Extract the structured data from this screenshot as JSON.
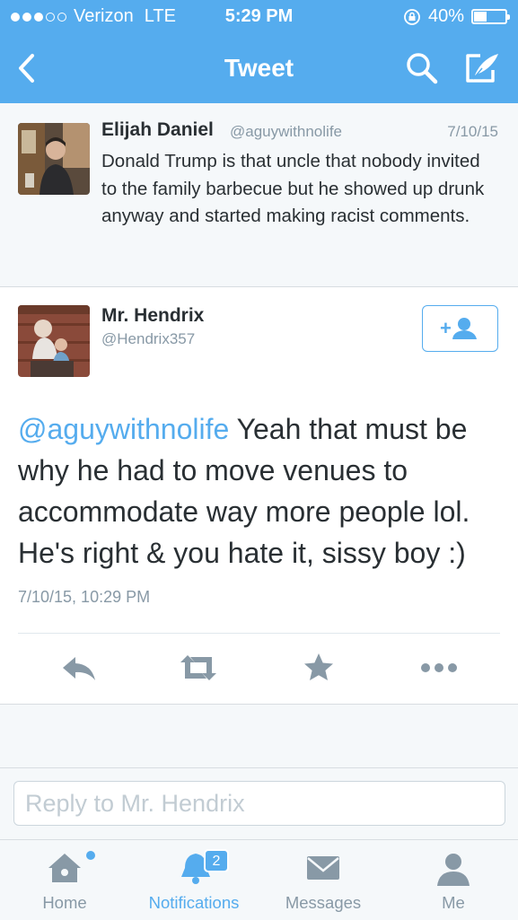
{
  "status_bar": {
    "carrier": "Verizon",
    "network": "LTE",
    "time": "5:29 PM",
    "battery": "40%",
    "battery_level": 0.4,
    "signal_bars": 3
  },
  "header": {
    "title": "Tweet",
    "icons": [
      "back-chevron-icon",
      "search-icon",
      "compose-icon"
    ]
  },
  "parent_tweet": {
    "name": "Elijah Daniel",
    "handle": "@aguywithnolife",
    "date": "7/10/15",
    "text": "Donald Trump is that uncle that nobody invited to the family barbecue but he showed up drunk anyway and started making racist comments."
  },
  "main_tweet": {
    "name": "Mr. Hendrix",
    "handle": "@Hendrix357",
    "mention": "@aguywithnolife",
    "text": "Yeah that must be why he had to move venues to accommodate way more people lol. He's right & you hate it, sissy boy :)",
    "timestamp": "7/10/15, 10:29 PM",
    "actions": [
      "reply-icon",
      "retweet-icon",
      "favorite-icon",
      "more-icon"
    ]
  },
  "reply": {
    "placeholder": "Reply to Mr. Hendrix"
  },
  "tabs": [
    {
      "label": "Home",
      "icon": "home-icon"
    },
    {
      "label": "Notifications",
      "icon": "notifications-bell-icon",
      "badge": "2"
    },
    {
      "label": "Messages",
      "icon": "messages-envelope-icon"
    },
    {
      "label": "Me",
      "icon": "profile-icon"
    }
  ],
  "colors": {
    "accent": "#55acee",
    "text": "#292f33",
    "muted": "#8899a6",
    "background": "#f5f8fa"
  }
}
